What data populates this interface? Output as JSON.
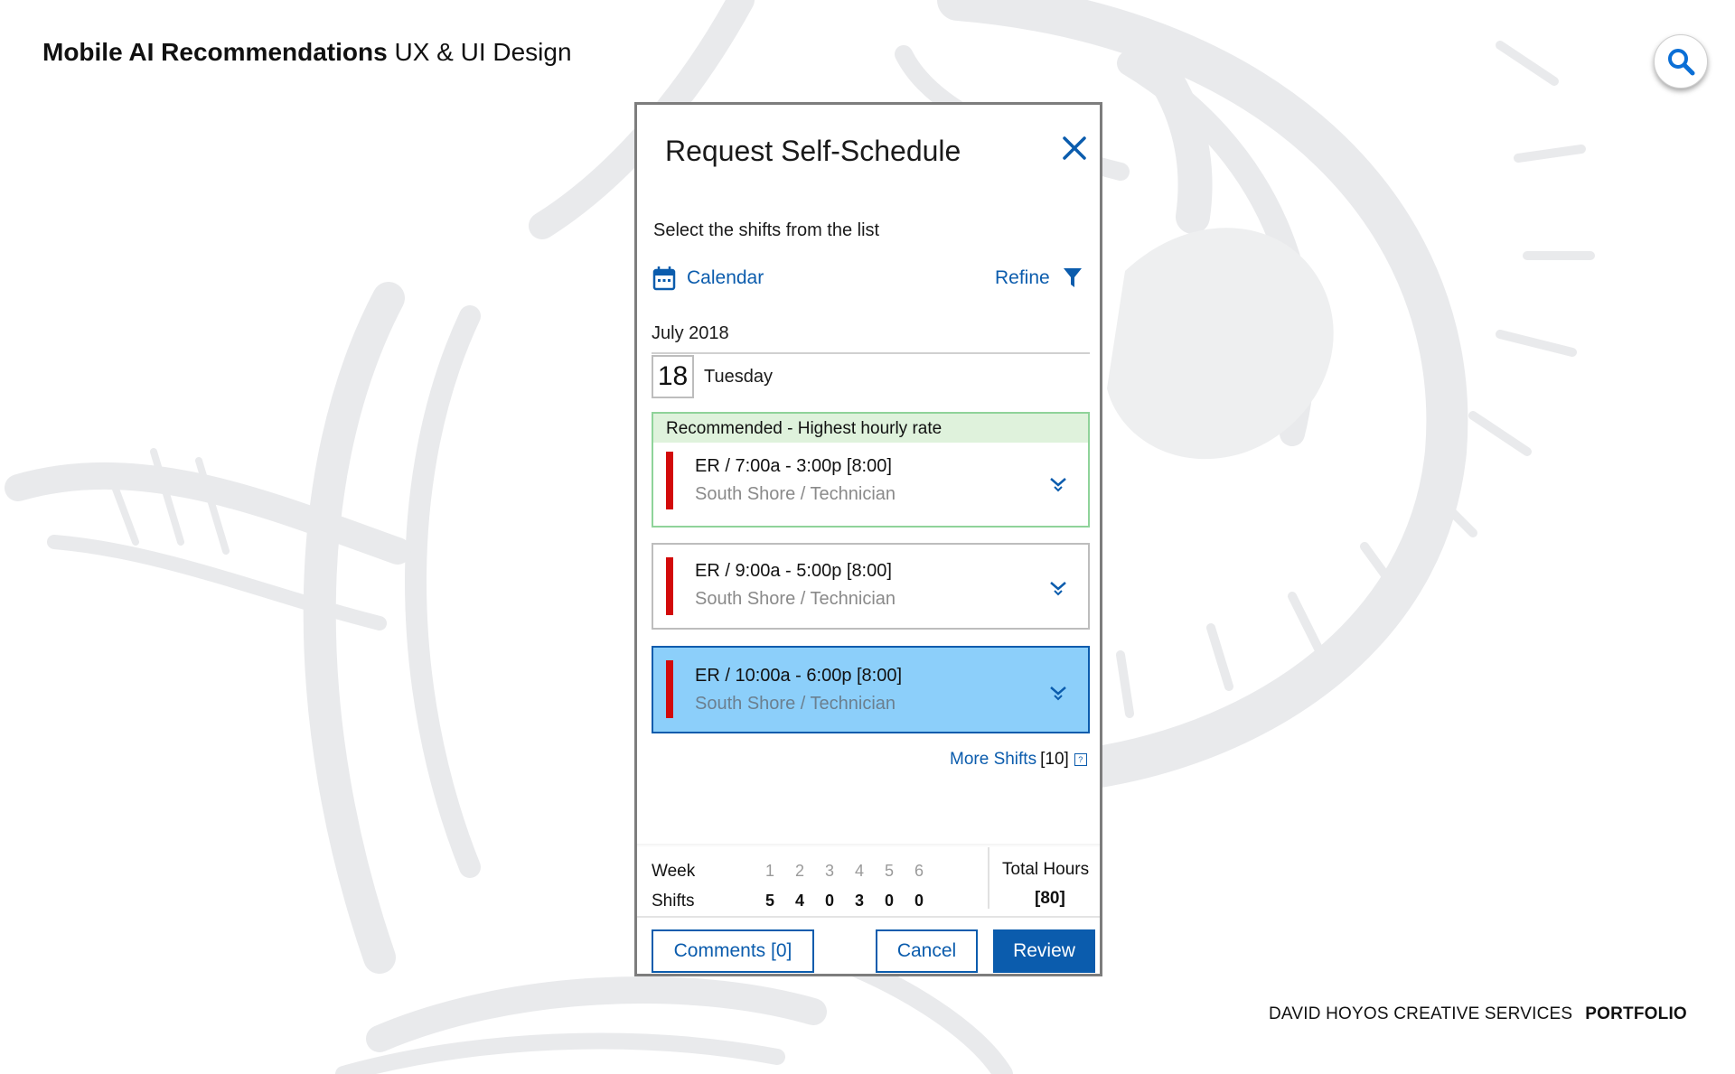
{
  "header": {
    "title_bold": "Mobile AI Recommendations",
    "title_rest": " UX & UI Design"
  },
  "footer": {
    "company": "DAVID HOYOS CREATIVE SERVICES",
    "portfolio": "PORTFOLIO"
  },
  "dialog": {
    "title": "Request Self-Schedule",
    "instruction": "Select the shifts from the list",
    "calendar_label": "Calendar",
    "refine_label": "Refine",
    "month": "July 2018",
    "day_number": "18",
    "day_name": "Tuesday",
    "recommended_label": "Recommended - Highest hourly rate",
    "shifts": [
      {
        "time": "ER / 7:00a - 3:00p [8:00]",
        "location": "South Shore / Technician"
      },
      {
        "time": "ER / 9:00a - 5:00p [8:00]",
        "location": "South Shore / Technician"
      },
      {
        "time": "ER / 10:00a - 6:00p [8:00]",
        "location": "South Shore / Technician"
      }
    ],
    "more_shifts_label": "More Shifts",
    "more_shifts_count": "[10]",
    "more_shifts_icon": "?",
    "summary": {
      "week_label": "Week",
      "shifts_label": "Shifts",
      "weeks": [
        "1",
        "2",
        "3",
        "4",
        "5",
        "6"
      ],
      "shift_counts": [
        "5",
        "4",
        "0",
        "3",
        "0",
        "0"
      ],
      "total_hours_label": "Total Hours",
      "total_hours_value": "[80]"
    },
    "buttons": {
      "comments": "Comments [0]",
      "cancel": "Cancel",
      "review": "Review"
    }
  },
  "colors": {
    "accent": "#0b5cad",
    "shift_marker": "#d20a0a",
    "recommended_border": "#8fd39a",
    "recommended_bg": "#dff2dc",
    "selected_bg": "#8ccffa"
  },
  "icons": {
    "search": "search-icon",
    "close": "close-icon",
    "calendar": "calendar-icon",
    "filter": "filter-icon",
    "expand": "chevron-down-icon"
  }
}
